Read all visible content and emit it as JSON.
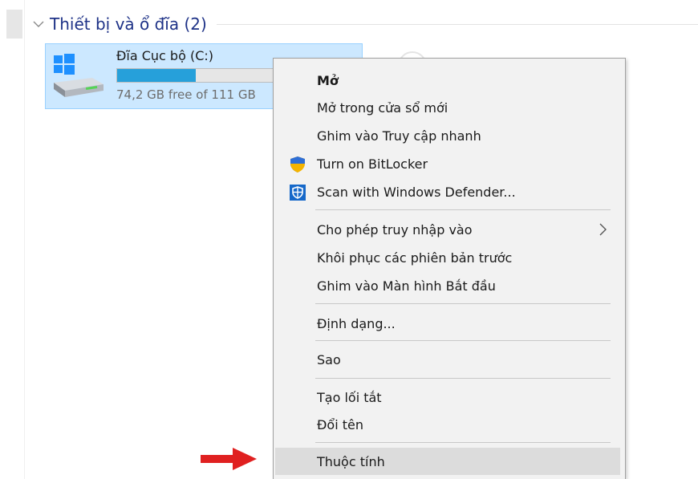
{
  "group": {
    "title": "Thiết bị và ổ đĩa (2)",
    "icon": "chevron-down-icon"
  },
  "drive": {
    "name": "Đĩa Cục bộ (C:)",
    "space_text": "74,2 GB free of 111 GB",
    "used_fraction": 0.33,
    "icon": "windows-drive-icon"
  },
  "menu": {
    "items": [
      {
        "label": "Mở"
      },
      {
        "label": "Mở trong cửa sổ mới"
      },
      {
        "label": "Ghim vào Truy cập nhanh"
      },
      {
        "label": "Turn on BitLocker",
        "icon": "bitlocker-shield-icon"
      },
      {
        "label": "Scan with Windows Defender...",
        "icon": "defender-icon"
      },
      {
        "label": "Cho phép truy nhập vào",
        "icon": "chevron-right-icon"
      },
      {
        "label": "Khôi phục các phiên bản trước"
      },
      {
        "label": "Ghim vào Màn hình Bắt đầu"
      },
      {
        "label": "Định dạng..."
      },
      {
        "label": "Sao"
      },
      {
        "label": "Tạo lối tắt"
      },
      {
        "label": "Đổi tên"
      },
      {
        "label": "Thuộc tính"
      }
    ]
  },
  "colors": {
    "group_title": "#1e3287",
    "selection_bg": "#cce8ff",
    "progress_fill": "#26a0da",
    "menu_bg": "#f2f2f2",
    "arrow": "#e02020"
  }
}
